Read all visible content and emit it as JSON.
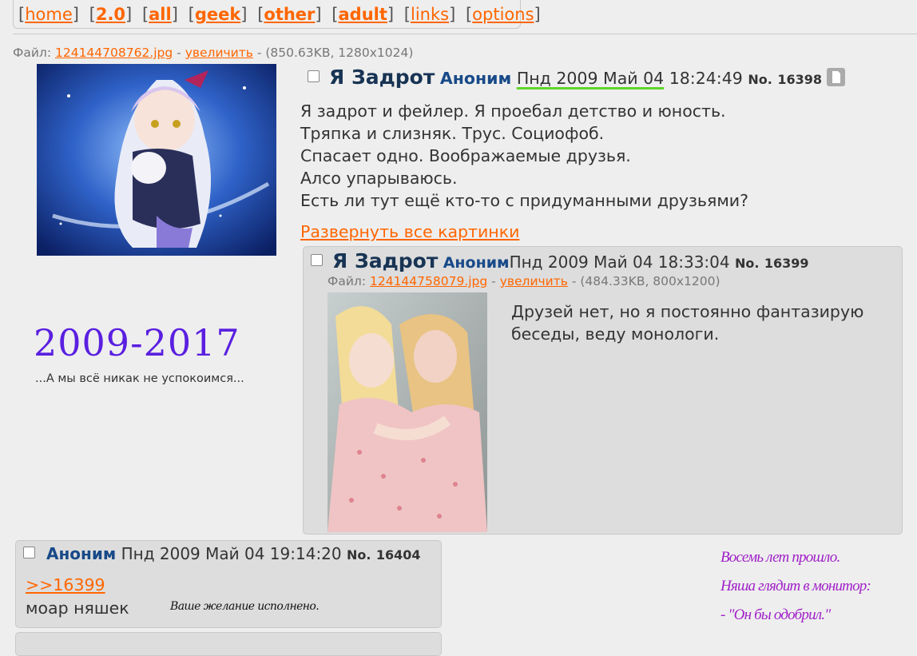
{
  "nav": {
    "items": [
      {
        "label": "home",
        "bold": false
      },
      {
        "label": "2.0",
        "bold": true
      },
      {
        "label": "all",
        "bold": true
      },
      {
        "label": "geek",
        "bold": true
      },
      {
        "label": "other",
        "bold": true
      },
      {
        "label": "adult",
        "bold": true
      },
      {
        "label": "links",
        "bold": false
      },
      {
        "label": "options",
        "bold": false
      }
    ]
  },
  "file_label": "Файл:",
  "enlarge_label": "увеличить",
  "op": {
    "file_name": "124144708762.jpg",
    "file_meta": "(850.63KB, 1280x1024)",
    "subject": "Я Задрот",
    "name": "Аноним",
    "date": "Пнд 2009 Май 04",
    "time": "18:24:49",
    "no_label": "No.",
    "number": "16398",
    "body": [
      "Я задрот и фейлер. Я проебал детство и юность.",
      "Тряпка и слизняк. Трус. Социофоб.",
      "Спасает одно. Воображаемые друзья.",
      "Алсо упарываюсь.",
      "Есть ли тут ещё кто-то с придуманными друзьями?"
    ],
    "expand_link": "Развернуть все картинки"
  },
  "reply1": {
    "subject": "Я Задрот",
    "name": "Аноним",
    "datetime": "Пнд 2009 Май 04 18:33:04",
    "no_label": "No.",
    "number": "16399",
    "file_name": "124144758079.jpg",
    "file_meta": "(484.33KB, 800x1200)",
    "body": [
      "Друзей нет, но я постоянно фантазирую",
      "беседы, веду монологи."
    ]
  },
  "reply2": {
    "name": "Аноним",
    "datetime": "Пнд 2009 Май 04 19:14:20",
    "no_label": "No.",
    "number": "16404",
    "quote": ">>16399",
    "body": "моар няшек",
    "image_caption": "Ваше желание исполнено."
  },
  "sidebar": {
    "logo_text": "2009-2017",
    "tagline": "...А мы всё никак не успокоимся..."
  },
  "poem": [
    "Восемь лет прошло.",
    "Няша глядит в монитор:",
    "- \"Он бы одобрил.\""
  ],
  "colors": {
    "link": "#ff6600",
    "name": "#184a88",
    "subject": "#183454",
    "logo": "#5a1fe0",
    "poem": "#a020c8",
    "date_underline": "#5ed62a"
  }
}
